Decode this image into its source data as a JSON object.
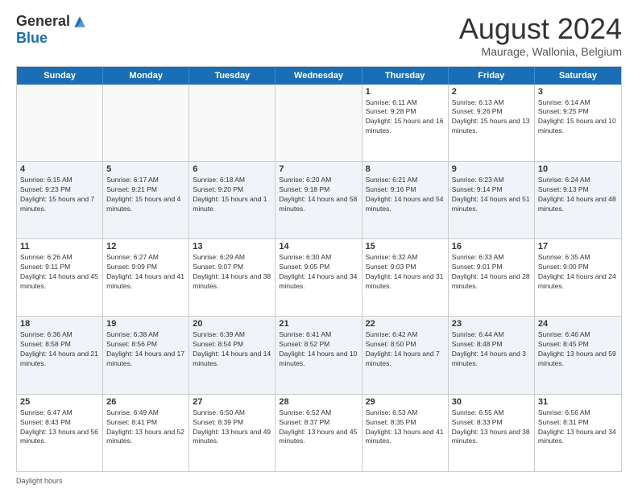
{
  "logo": {
    "general": "General",
    "blue": "Blue"
  },
  "title": "August 2024",
  "subtitle": "Maurage, Wallonia, Belgium",
  "days_of_week": [
    "Sunday",
    "Monday",
    "Tuesday",
    "Wednesday",
    "Thursday",
    "Friday",
    "Saturday"
  ],
  "footer_label": "Daylight hours",
  "weeks": [
    [
      {
        "num": "",
        "info": ""
      },
      {
        "num": "",
        "info": ""
      },
      {
        "num": "",
        "info": ""
      },
      {
        "num": "",
        "info": ""
      },
      {
        "num": "1",
        "info": "Sunrise: 6:11 AM\nSunset: 9:28 PM\nDaylight: 15 hours and 16 minutes."
      },
      {
        "num": "2",
        "info": "Sunrise: 6:13 AM\nSunset: 9:26 PM\nDaylight: 15 hours and 13 minutes."
      },
      {
        "num": "3",
        "info": "Sunrise: 6:14 AM\nSunset: 9:25 PM\nDaylight: 15 hours and 10 minutes."
      }
    ],
    [
      {
        "num": "4",
        "info": "Sunrise: 6:15 AM\nSunset: 9:23 PM\nDaylight: 15 hours and 7 minutes."
      },
      {
        "num": "5",
        "info": "Sunrise: 6:17 AM\nSunset: 9:21 PM\nDaylight: 15 hours and 4 minutes."
      },
      {
        "num": "6",
        "info": "Sunrise: 6:18 AM\nSunset: 9:20 PM\nDaylight: 15 hours and 1 minute."
      },
      {
        "num": "7",
        "info": "Sunrise: 6:20 AM\nSunset: 9:18 PM\nDaylight: 14 hours and 58 minutes."
      },
      {
        "num": "8",
        "info": "Sunrise: 6:21 AM\nSunset: 9:16 PM\nDaylight: 14 hours and 54 minutes."
      },
      {
        "num": "9",
        "info": "Sunrise: 6:23 AM\nSunset: 9:14 PM\nDaylight: 14 hours and 51 minutes."
      },
      {
        "num": "10",
        "info": "Sunrise: 6:24 AM\nSunset: 9:13 PM\nDaylight: 14 hours and 48 minutes."
      }
    ],
    [
      {
        "num": "11",
        "info": "Sunrise: 6:26 AM\nSunset: 9:11 PM\nDaylight: 14 hours and 45 minutes."
      },
      {
        "num": "12",
        "info": "Sunrise: 6:27 AM\nSunset: 9:09 PM\nDaylight: 14 hours and 41 minutes."
      },
      {
        "num": "13",
        "info": "Sunrise: 6:29 AM\nSunset: 9:07 PM\nDaylight: 14 hours and 38 minutes."
      },
      {
        "num": "14",
        "info": "Sunrise: 6:30 AM\nSunset: 9:05 PM\nDaylight: 14 hours and 34 minutes."
      },
      {
        "num": "15",
        "info": "Sunrise: 6:32 AM\nSunset: 9:03 PM\nDaylight: 14 hours and 31 minutes."
      },
      {
        "num": "16",
        "info": "Sunrise: 6:33 AM\nSunset: 9:01 PM\nDaylight: 14 hours and 28 minutes."
      },
      {
        "num": "17",
        "info": "Sunrise: 6:35 AM\nSunset: 9:00 PM\nDaylight: 14 hours and 24 minutes."
      }
    ],
    [
      {
        "num": "18",
        "info": "Sunrise: 6:36 AM\nSunset: 8:58 PM\nDaylight: 14 hours and 21 minutes."
      },
      {
        "num": "19",
        "info": "Sunrise: 6:38 AM\nSunset: 8:56 PM\nDaylight: 14 hours and 17 minutes."
      },
      {
        "num": "20",
        "info": "Sunrise: 6:39 AM\nSunset: 8:54 PM\nDaylight: 14 hours and 14 minutes."
      },
      {
        "num": "21",
        "info": "Sunrise: 6:41 AM\nSunset: 8:52 PM\nDaylight: 14 hours and 10 minutes."
      },
      {
        "num": "22",
        "info": "Sunrise: 6:42 AM\nSunset: 8:50 PM\nDaylight: 14 hours and 7 minutes."
      },
      {
        "num": "23",
        "info": "Sunrise: 6:44 AM\nSunset: 8:48 PM\nDaylight: 14 hours and 3 minutes."
      },
      {
        "num": "24",
        "info": "Sunrise: 6:46 AM\nSunset: 8:45 PM\nDaylight: 13 hours and 59 minutes."
      }
    ],
    [
      {
        "num": "25",
        "info": "Sunrise: 6:47 AM\nSunset: 8:43 PM\nDaylight: 13 hours and 56 minutes."
      },
      {
        "num": "26",
        "info": "Sunrise: 6:49 AM\nSunset: 8:41 PM\nDaylight: 13 hours and 52 minutes."
      },
      {
        "num": "27",
        "info": "Sunrise: 6:50 AM\nSunset: 8:39 PM\nDaylight: 13 hours and 49 minutes."
      },
      {
        "num": "28",
        "info": "Sunrise: 6:52 AM\nSunset: 8:37 PM\nDaylight: 13 hours and 45 minutes."
      },
      {
        "num": "29",
        "info": "Sunrise: 6:53 AM\nSunset: 8:35 PM\nDaylight: 13 hours and 41 minutes."
      },
      {
        "num": "30",
        "info": "Sunrise: 6:55 AM\nSunset: 8:33 PM\nDaylight: 13 hours and 38 minutes."
      },
      {
        "num": "31",
        "info": "Sunrise: 6:56 AM\nSunset: 8:31 PM\nDaylight: 13 hours and 34 minutes."
      }
    ]
  ]
}
